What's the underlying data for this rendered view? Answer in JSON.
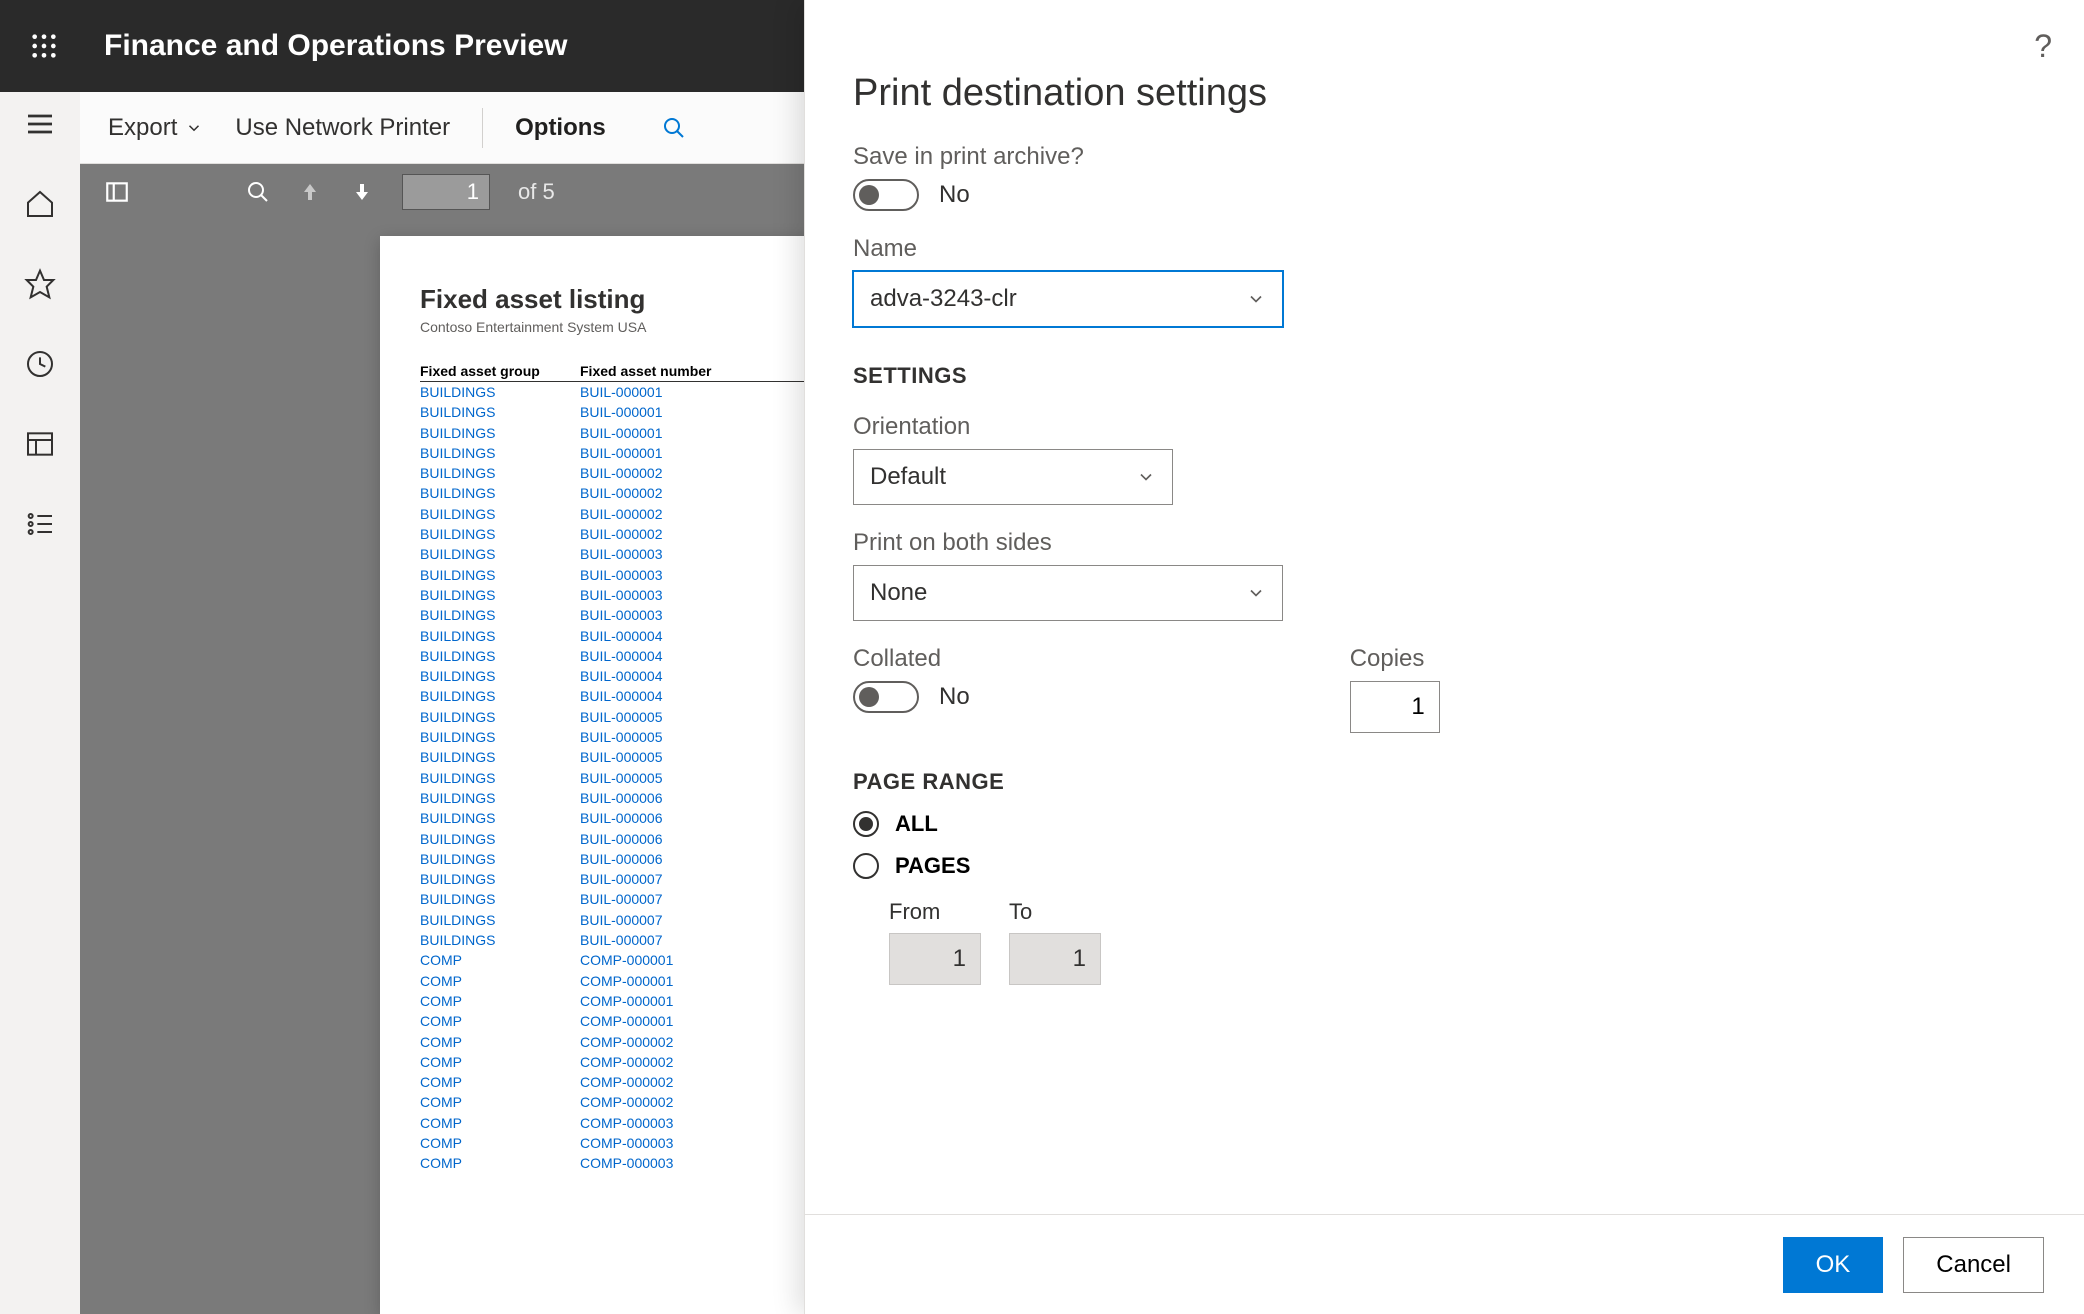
{
  "header": {
    "title": "Finance and Operations Preview"
  },
  "actionbar": {
    "export": "Export",
    "use_network_printer": "Use Network Printer",
    "options": "Options"
  },
  "report_toolbar": {
    "page_current": "1",
    "page_of": "of 5"
  },
  "report": {
    "title": "Fixed asset listing",
    "subtitle": "Contoso Entertainment System USA",
    "col_group": "Fixed asset group",
    "col_number": "Fixed asset number",
    "rows": [
      {
        "g": "BUILDINGS",
        "n": "BUIL-000001"
      },
      {
        "g": "BUILDINGS",
        "n": "BUIL-000001"
      },
      {
        "g": "BUILDINGS",
        "n": "BUIL-000001"
      },
      {
        "g": "BUILDINGS",
        "n": "BUIL-000001"
      },
      {
        "g": "BUILDINGS",
        "n": "BUIL-000002"
      },
      {
        "g": "BUILDINGS",
        "n": "BUIL-000002"
      },
      {
        "g": "BUILDINGS",
        "n": "BUIL-000002"
      },
      {
        "g": "BUILDINGS",
        "n": "BUIL-000002"
      },
      {
        "g": "BUILDINGS",
        "n": "BUIL-000003"
      },
      {
        "g": "BUILDINGS",
        "n": "BUIL-000003"
      },
      {
        "g": "BUILDINGS",
        "n": "BUIL-000003"
      },
      {
        "g": "BUILDINGS",
        "n": "BUIL-000003"
      },
      {
        "g": "BUILDINGS",
        "n": "BUIL-000004"
      },
      {
        "g": "BUILDINGS",
        "n": "BUIL-000004"
      },
      {
        "g": "BUILDINGS",
        "n": "BUIL-000004"
      },
      {
        "g": "BUILDINGS",
        "n": "BUIL-000004"
      },
      {
        "g": "BUILDINGS",
        "n": "BUIL-000005"
      },
      {
        "g": "BUILDINGS",
        "n": "BUIL-000005"
      },
      {
        "g": "BUILDINGS",
        "n": "BUIL-000005"
      },
      {
        "g": "BUILDINGS",
        "n": "BUIL-000005"
      },
      {
        "g": "BUILDINGS",
        "n": "BUIL-000006"
      },
      {
        "g": "BUILDINGS",
        "n": "BUIL-000006"
      },
      {
        "g": "BUILDINGS",
        "n": "BUIL-000006"
      },
      {
        "g": "BUILDINGS",
        "n": "BUIL-000006"
      },
      {
        "g": "BUILDINGS",
        "n": "BUIL-000007"
      },
      {
        "g": "BUILDINGS",
        "n": "BUIL-000007"
      },
      {
        "g": "BUILDINGS",
        "n": "BUIL-000007"
      },
      {
        "g": "BUILDINGS",
        "n": "BUIL-000007"
      },
      {
        "g": "COMP",
        "n": "COMP-000001"
      },
      {
        "g": "COMP",
        "n": "COMP-000001"
      },
      {
        "g": "COMP",
        "n": "COMP-000001"
      },
      {
        "g": "COMP",
        "n": "COMP-000001"
      },
      {
        "g": "COMP",
        "n": "COMP-000002"
      },
      {
        "g": "COMP",
        "n": "COMP-000002"
      },
      {
        "g": "COMP",
        "n": "COMP-000002"
      },
      {
        "g": "COMP",
        "n": "COMP-000002"
      },
      {
        "g": "COMP",
        "n": "COMP-000003"
      },
      {
        "g": "COMP",
        "n": "COMP-000003"
      },
      {
        "g": "COMP",
        "n": "COMP-000003"
      }
    ]
  },
  "panel": {
    "title": "Print destination settings",
    "save_archive_label": "Save in print archive?",
    "save_archive_value": "No",
    "name_label": "Name",
    "name_value": "adva-3243-clr",
    "settings_hdr": "SETTINGS",
    "orientation_label": "Orientation",
    "orientation_value": "Default",
    "both_sides_label": "Print on both sides",
    "both_sides_value": "None",
    "collated_label": "Collated",
    "collated_value": "No",
    "copies_label": "Copies",
    "copies_value": "1",
    "page_range_hdr": "PAGE RANGE",
    "range_all": "ALL",
    "range_pages": "PAGES",
    "from_label": "From",
    "from_value": "1",
    "to_label": "To",
    "to_value": "1",
    "ok": "OK",
    "cancel": "Cancel"
  }
}
